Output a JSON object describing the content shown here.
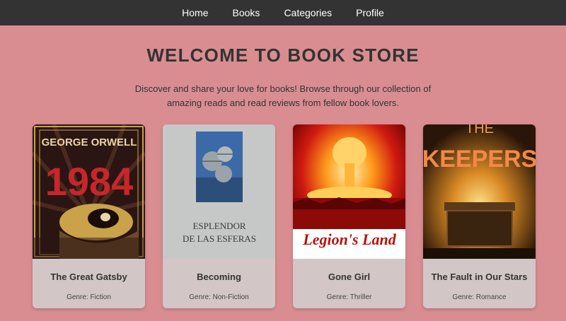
{
  "nav": {
    "items": [
      {
        "label": "Home"
      },
      {
        "label": "Books"
      },
      {
        "label": "Categories"
      },
      {
        "label": "Profile"
      }
    ]
  },
  "hero": {
    "title": "WELCOME TO BOOK STORE",
    "intro": "Discover and share your love for books! Browse through our collection of amazing reads and read reviews from fellow book lovers."
  },
  "books": [
    {
      "title": "The Great Gatsby",
      "genre": "Genre: Fiction",
      "cover_author": "GEORGE ORWELL",
      "cover_title": "1984"
    },
    {
      "title": "Becoming",
      "genre": "Genre: Non-Fiction",
      "cover_title_line1": "ESPLENDOR",
      "cover_title_line2": "DE LAS ESFERAS"
    },
    {
      "title": "Gone Girl",
      "genre": "Genre: Thriller",
      "cover_title": "Legion's Land"
    },
    {
      "title": "The Fault in Our Stars",
      "genre": "Genre: Romance",
      "cover_top": "THE",
      "cover_title": "KEEPERS"
    }
  ],
  "colors": {
    "background": "#d98d91",
    "navbar": "#333333",
    "card": "#d2c7c6",
    "text": "#333333"
  }
}
